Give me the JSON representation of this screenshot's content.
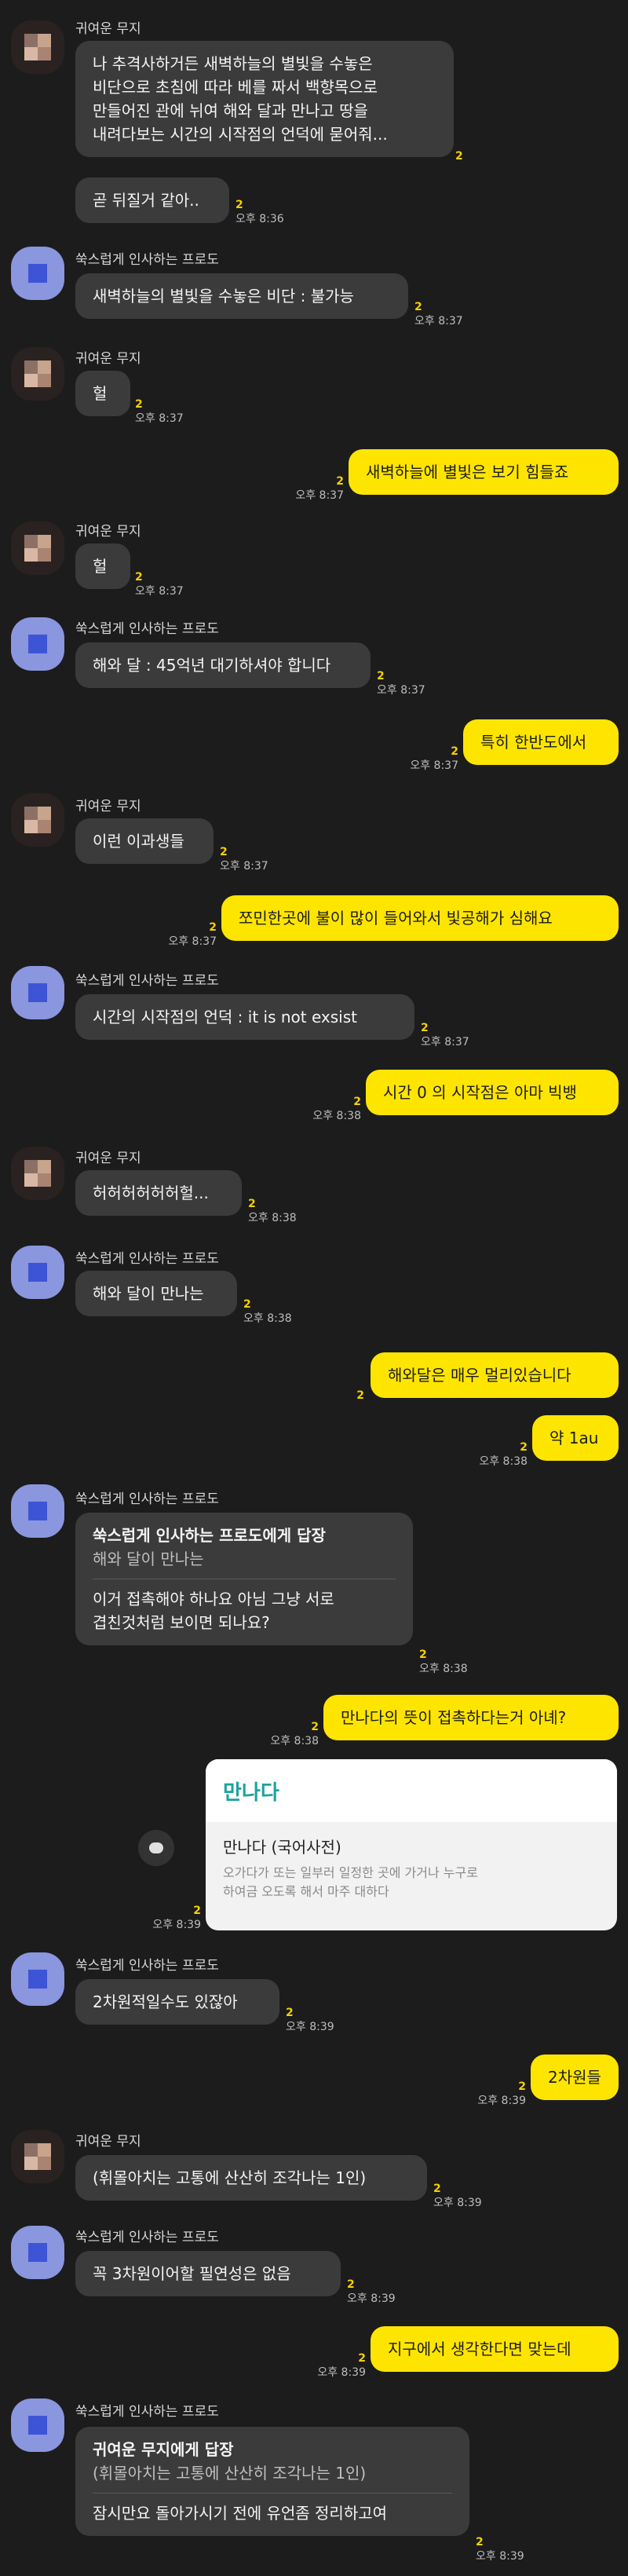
{
  "senders": {
    "a": "귀여운 무지",
    "b": "쑥스럽게 인사하는 프로도"
  },
  "unread": "2",
  "messages": [
    {
      "text": "나 추격사하거든 새벽하늘의 별빛을 수놓은\n비단으로 초침에 따라 베를 짜서 백향목으로\n만들어진 관에 뉘여 해와 달과 만나고 땅을\n내려다보는 시간의 시작점의 언덕에 묻어줘..."
    },
    {
      "text": "곧 뒤질거 같아..",
      "time": "오후 8:36"
    },
    {
      "text": "새벽하늘의 별빛을 수놓은 비단 : 불가능",
      "time": "오후 8:37"
    },
    {
      "text": "헐",
      "time": "오후 8:37"
    },
    {
      "text": "새벽하늘에 별빛은 보기 힘들죠",
      "time": "오후 8:37"
    },
    {
      "text": "헐",
      "time": "오후 8:37"
    },
    {
      "text": "해와 달 : 45억년 대기하셔야 합니다",
      "time": "오후 8:37"
    },
    {
      "text": "특히 한반도에서",
      "time": "오후 8:37"
    },
    {
      "text": "이런 이과생들",
      "time": "오후 8:37"
    },
    {
      "text": "쪼민한곳에 불이 많이 들어와서 빛공해가 심해요",
      "time": "오후 8:37"
    },
    {
      "text": "시간의 시작점의 언덕 : it is not exsist",
      "time": "오후 8:37"
    },
    {
      "text": "시간 0 의 시작점은 아마 빅뱅",
      "time": "오후 8:38"
    },
    {
      "text": "허허허허허허헐...",
      "time": "오후 8:38"
    },
    {
      "text": "해와 달이 만나는",
      "time": "오후 8:38"
    },
    {
      "text": "해와달은 매우 멀리있습니다"
    },
    {
      "text": "약 1au",
      "time": "오후 8:38"
    },
    {
      "reply_head": "쑥스럽게 인사하는 프로도에게 답장",
      "reply_quote": "해와 달이 만나는",
      "text": "이거 접촉해야 하나요 아님 그냥 서로\n겹친것처럼 보이면 되나요?",
      "time": "오후 8:38"
    },
    {
      "text": "만나다의 뜻이 접촉하다는거 아녜?",
      "time": "오후 8:38"
    },
    {
      "card_title": "만나다",
      "card_word": "만나다 (국어사전)",
      "card_desc": "오가다가 또는 일부러 일정한 곳에 가거나 누구로\n하여금 오도록 해서 마주 대하다",
      "time": "오후 8:39"
    },
    {
      "text": "2차원적일수도 있잖아",
      "time": "오후 8:39"
    },
    {
      "text": "2차원들",
      "time": "오후 8:39"
    },
    {
      "text": "(휘몰아치는 고통에 산산히 조각나는 1인)",
      "time": "오후 8:39"
    },
    {
      "text": "꼭 3차원이어할 필연성은 없음",
      "time": "오후 8:39"
    },
    {
      "text": "지구에서 생각한다면 맞는데",
      "time": "오후 8:39"
    },
    {
      "reply_head": "귀여운 무지에게 답장",
      "reply_quote": "(휘몰아치는 고통에 산산히 조각나는 1인)",
      "text": "잠시만요 돌아가시기 전에 유언좀 정리하고여",
      "time": "오후 8:39"
    }
  ],
  "icons": {
    "share": "speech-bubble-icon"
  },
  "colors": {
    "background": "#1c1c1c",
    "incoming": "#3b3b3b",
    "outgoing": "#fee500",
    "unread": "#f5d000",
    "card_title": "#1aa3a0"
  }
}
